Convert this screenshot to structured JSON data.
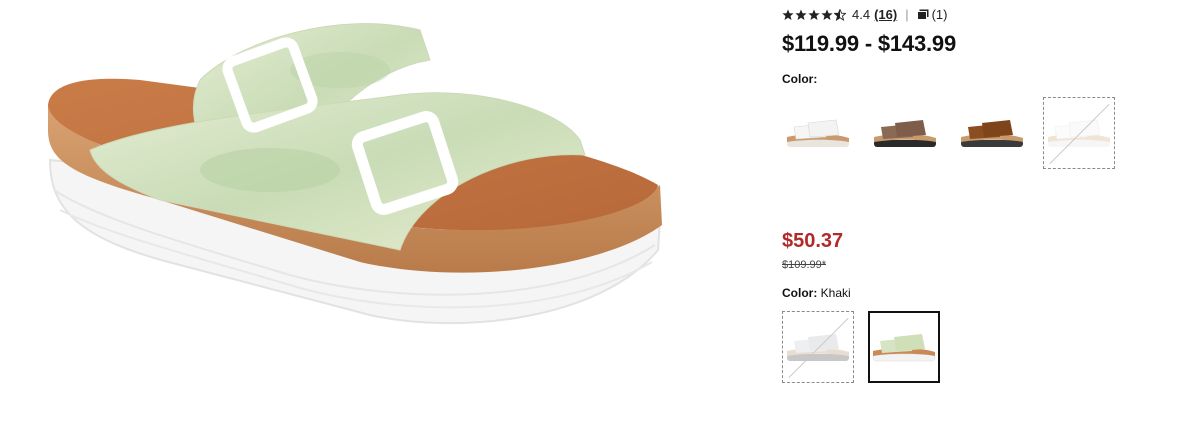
{
  "product": {
    "image_alt": "sandal-product-image"
  },
  "rating": {
    "value": "4.4",
    "stars": 4.4,
    "review_count": "(16)",
    "separator": "|",
    "photo_count": "(1)"
  },
  "price_range": "$119.99 - $143.99",
  "color_group_1": {
    "label": "Color:",
    "swatches": [
      {
        "name": "white",
        "available": true
      },
      {
        "name": "brown-black-sole",
        "available": true
      },
      {
        "name": "tan-brown",
        "available": true
      },
      {
        "name": "white-unavailable",
        "available": false
      }
    ]
  },
  "sale": {
    "price": "$50.37",
    "original_price": "$109.99*"
  },
  "color_group_2": {
    "label": "Color:",
    "selected_value": "Khaki",
    "swatches": [
      {
        "name": "grey-unavailable",
        "available": false
      },
      {
        "name": "khaki",
        "available": true,
        "selected": true
      }
    ]
  },
  "colors": {
    "sale_red": "#b12a2a",
    "strap_mint": "#d6e4c3",
    "cork": "#c98e5d",
    "footbed": "#c47a48",
    "sole_white": "#f4f4f4"
  }
}
